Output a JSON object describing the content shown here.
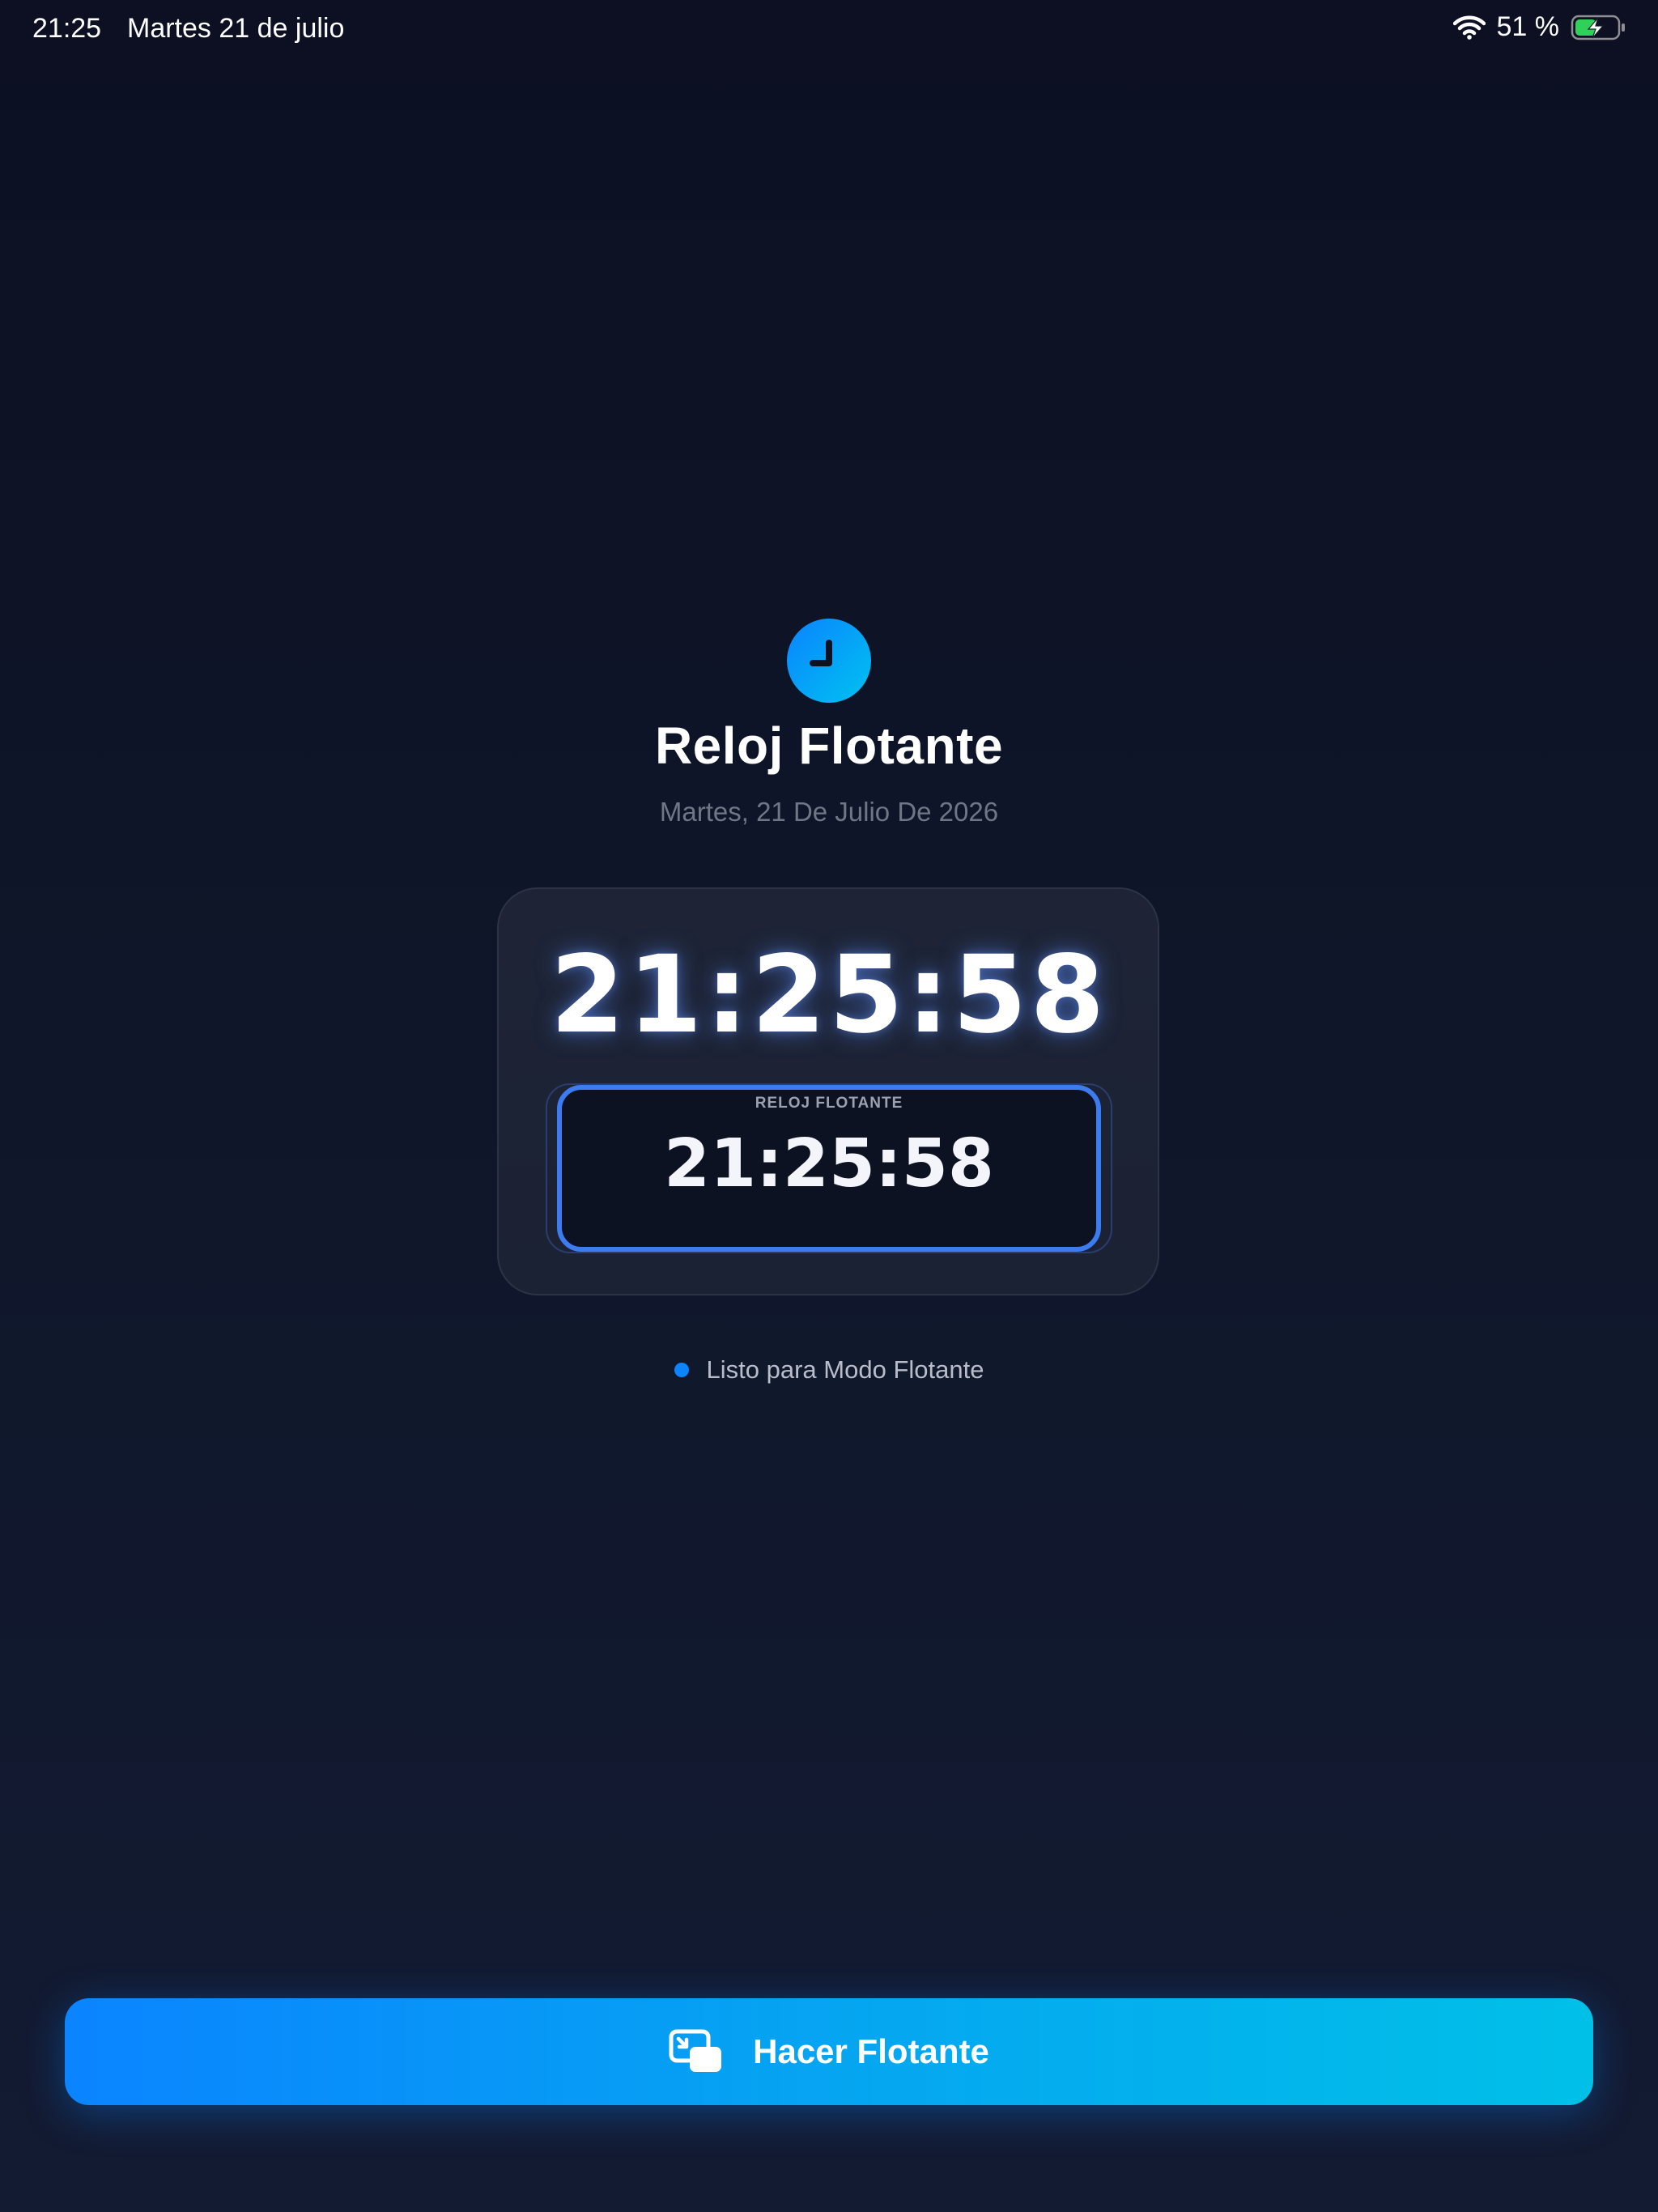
{
  "status_bar": {
    "time": "21:25",
    "date": "Martes 21 de julio",
    "battery_percent": "51 %",
    "battery_level": 0.51,
    "battery_charging": true,
    "battery_color": "#30d158"
  },
  "app": {
    "icon": "clock-icon",
    "title": "Reloj Flotante",
    "date_long": "Martes, 21 De Julio De 2026"
  },
  "clock": {
    "time": "21:25:58"
  },
  "floating_preview": {
    "label": "RELOJ FLOTANTE",
    "time": "21:25:58",
    "border_color": "#3d7bf0"
  },
  "status": {
    "text": "Listo para Modo Flotante",
    "dot_color": "#0a84ff"
  },
  "primary_button": {
    "label": "Hacer Flotante",
    "icon": "picture-in-picture-icon"
  },
  "colors": {
    "accent": "#0a84ff",
    "accent_end": "#00c0e8",
    "background": "#0f1629"
  }
}
